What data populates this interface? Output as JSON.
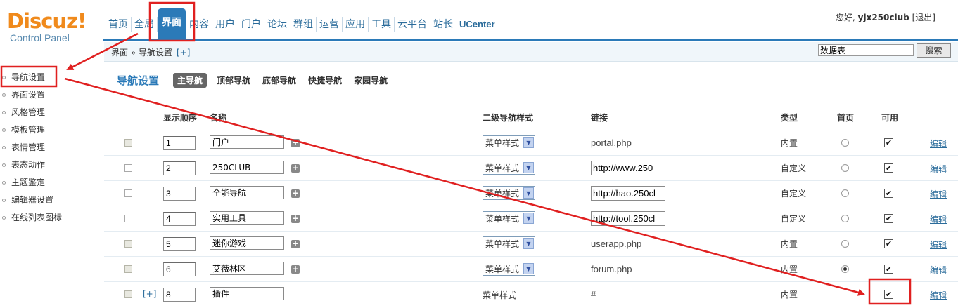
{
  "header": {
    "logo_text": "Discuz!",
    "logo_sub": "Control Panel",
    "greeting": "您好,",
    "username": "yjx250club",
    "logout": "[退出]",
    "site_truncated": "站"
  },
  "nav": [
    "首页",
    "全局",
    "界面",
    "内容",
    "用户",
    "门户",
    "论坛",
    "群组",
    "运营",
    "应用",
    "工具",
    "云平台",
    "站长",
    "UCenter"
  ],
  "nav_active": "界面",
  "breadcrumb": {
    "path": "界面 » 导航设置",
    "add": "[+]"
  },
  "search": {
    "value": "数据表",
    "button": "搜索"
  },
  "sidebar": [
    "导航设置",
    "界面设置",
    "风格管理",
    "模板管理",
    "表情管理",
    "表态动作",
    "主题鉴定",
    "编辑器设置",
    "在线列表图标"
  ],
  "page": {
    "title": "导航设置",
    "tabs": [
      "主导航",
      "顶部导航",
      "底部导航",
      "快捷导航",
      "家园导航"
    ],
    "active_tab": "主导航"
  },
  "table": {
    "headers": {
      "order": "显示顺序",
      "name": "名称",
      "style": "二级导航样式",
      "link": "链接",
      "type": "类型",
      "home": "首页",
      "enabled": "可用"
    },
    "edit_label": "编辑",
    "add_plus": "[+]",
    "rows": [
      {
        "order": "1",
        "name": "门户",
        "style": "菜单样式",
        "link": "portal.php",
        "link_editable": false,
        "type": "内置",
        "home": false,
        "enabled": true,
        "gray": true
      },
      {
        "order": "2",
        "name": "250CLUB",
        "style": "菜单样式",
        "link": "http://www.250",
        "link_editable": true,
        "type": "自定义",
        "home": false,
        "enabled": true,
        "gray": false
      },
      {
        "order": "3",
        "name": "全能导航",
        "style": "菜单样式",
        "link": "http://hao.250cl",
        "link_editable": true,
        "type": "自定义",
        "home": false,
        "enabled": true,
        "gray": false
      },
      {
        "order": "4",
        "name": "实用工具",
        "style": "菜单样式",
        "link": "http://tool.250cl",
        "link_editable": true,
        "type": "自定义",
        "home": false,
        "enabled": true,
        "gray": false
      },
      {
        "order": "5",
        "name": "迷你游戏",
        "style": "菜单样式",
        "link": "userapp.php",
        "link_editable": false,
        "type": "内置",
        "home": false,
        "enabled": true,
        "gray": true
      },
      {
        "order": "6",
        "name": "艾薇林区",
        "style": "菜单样式",
        "link": "forum.php",
        "link_editable": false,
        "type": "内置",
        "home": true,
        "enabled": true,
        "gray": true
      },
      {
        "order": "8",
        "name": "插件",
        "style": "菜单样式",
        "link": "#",
        "link_editable": false,
        "type": "内置",
        "home": null,
        "enabled": true,
        "gray": true,
        "sub_item": true
      }
    ]
  },
  "colors": {
    "accent": "#2b7ab8",
    "logo": "#f08a1c",
    "annotation": "#e02020"
  }
}
